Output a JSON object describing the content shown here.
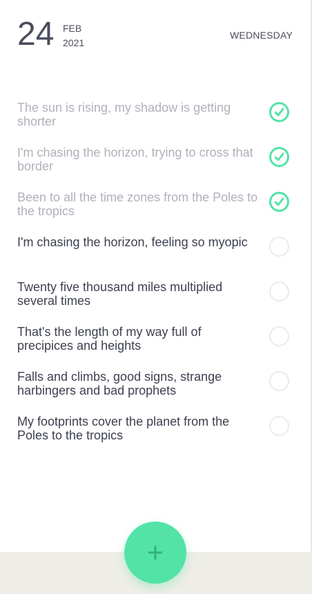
{
  "header": {
    "day": "24",
    "month": "FEB",
    "year": "2021",
    "weekday": "WEDNESDAY"
  },
  "tasks": [
    {
      "text": "The sun is rising, my shadow is getting shorter",
      "done": true
    },
    {
      "text": "I'm chasing the horizon, trying to cross that border",
      "done": true
    },
    {
      "text": "Been to all the time zones from the Poles to the tropics",
      "done": true
    },
    {
      "text": "I'm chasing the horizon, feeling so myopic",
      "done": false
    },
    {
      "text": "Twenty five thousand miles multiplied several times",
      "done": false
    },
    {
      "text": "That's the length of my way full of precipices and heights",
      "done": false
    },
    {
      "text": "Falls and climbs, good signs, strange harbingers and bad prophets",
      "done": false
    },
    {
      "text": "My footprints cover the planet from the Poles to the tropics",
      "done": false
    }
  ],
  "icons": {
    "check": "check-icon",
    "add": "plus-icon"
  },
  "colors": {
    "accent": "#53e3a6",
    "text_active": "#3d4050",
    "text_done": "#b0b1bc",
    "footer_bg": "#efede8"
  }
}
